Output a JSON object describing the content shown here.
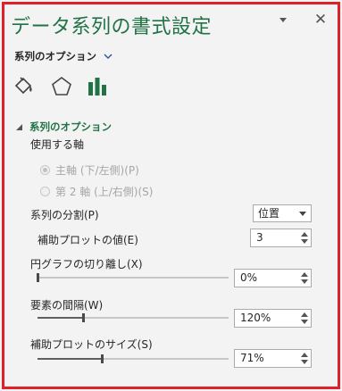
{
  "pane": {
    "title": "データ系列の書式設定",
    "options_dropdown_label": "系列のオプション",
    "tabs": [
      {
        "name": "fill-line",
        "icon": "paint-bucket-icon"
      },
      {
        "name": "effects",
        "icon": "pentagon-icon"
      },
      {
        "name": "series-options",
        "icon": "bar-chart-icon",
        "selected": true
      }
    ]
  },
  "colors": {
    "accent": "#217346",
    "highlight_frame": "#e0212a",
    "panel_bg": "#f3f3f3"
  },
  "series_options": {
    "section_title": "系列のオプション",
    "axis_label": "使用する軸",
    "axis_options": [
      {
        "label": "主軸 (下/左側)(P)",
        "selected": true,
        "disabled": true
      },
      {
        "label": "第 2 軸 (上/右側)(S)",
        "selected": false,
        "disabled": true
      }
    ],
    "split_label": "系列の分割(P)",
    "split_value": "位置",
    "secondary_plot_value_label": "補助プロットの値(E)",
    "secondary_plot_value": "3",
    "pie_explosion_label": "円グラフの切り離し(X)",
    "pie_explosion_value": "0%",
    "pie_explosion_level": 0.0,
    "gap_width_label": "要素の間隔(W)",
    "gap_width_value": "120%",
    "gap_width_level": 0.24,
    "second_plot_size_label": "補助プロットのサイズ(S)",
    "second_plot_size_value": "71%",
    "second_plot_size_level": 0.335
  }
}
